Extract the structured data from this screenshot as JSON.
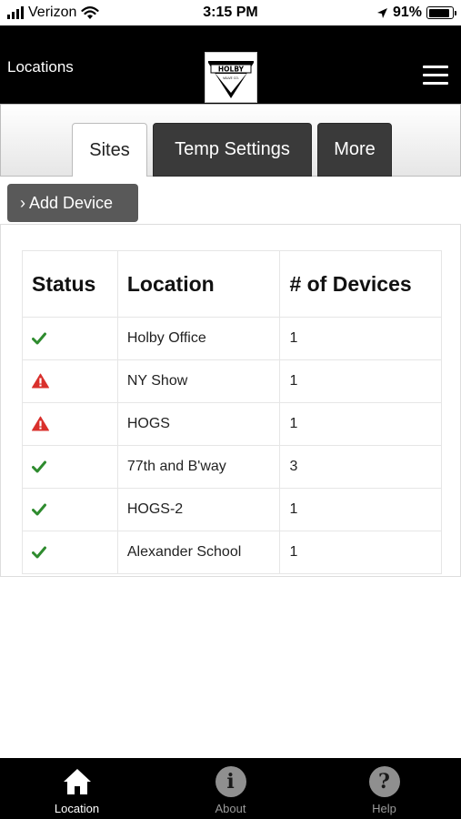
{
  "status_bar": {
    "carrier": "Verizon",
    "time": "3:15 PM",
    "battery": "91%",
    "battery_level": 0.91
  },
  "header": {
    "title": "Locations",
    "logo": {
      "text": "HOLBY",
      "subtext": "VALVE CO."
    }
  },
  "tabs": [
    {
      "label": "Sites",
      "active": true
    },
    {
      "label": "Temp Settings",
      "active": false
    },
    {
      "label": "More",
      "active": false
    }
  ],
  "add_device": {
    "label": "› Add Device"
  },
  "table": {
    "headers": [
      "Status",
      "Location",
      "# of Devices"
    ],
    "rows": [
      {
        "status": "ok",
        "location": "Holby Office",
        "devices": "1"
      },
      {
        "status": "warning",
        "location": "NY Show",
        "devices": "1"
      },
      {
        "status": "warning",
        "location": "HOGS",
        "devices": "1"
      },
      {
        "status": "ok",
        "location": "77th and B'way",
        "devices": "3"
      },
      {
        "status": "ok",
        "location": "HOGS-2",
        "devices": "1"
      },
      {
        "status": "ok",
        "location": "Alexander School",
        "devices": "1"
      }
    ]
  },
  "bottom_nav": [
    {
      "label": "Location",
      "icon": "home-icon",
      "active": true
    },
    {
      "label": "About",
      "icon": "info-icon",
      "active": false
    },
    {
      "label": "Help",
      "icon": "help-icon",
      "active": false
    }
  ],
  "colors": {
    "ok": "#2e8b2e",
    "warning": "#d9302c",
    "header_bg": "#000000",
    "tab_dark": "#3a3a3a",
    "button_bg": "#595959"
  }
}
